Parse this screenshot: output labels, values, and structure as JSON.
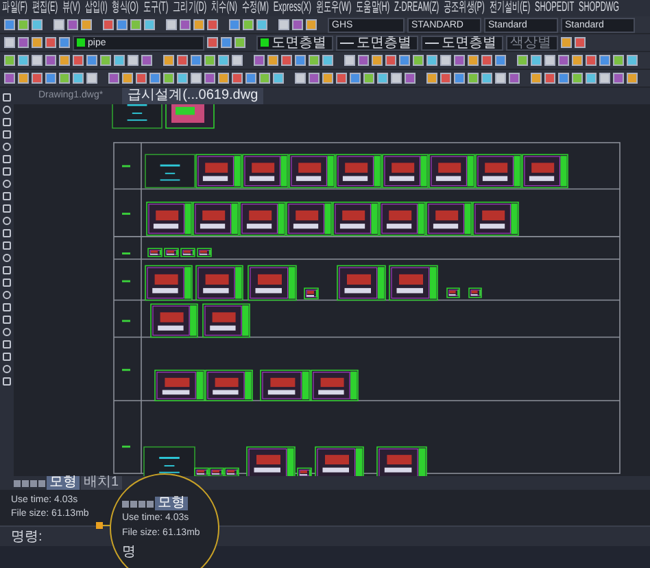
{
  "menu_bar": [
    "파일(F)",
    "편집(E)",
    "뷰(V)",
    "삽입(I)",
    "형식(O)",
    "도구(T)",
    "그리기(D)",
    "치수(N)",
    "수정(M)",
    "Express(X)",
    "윈도우(W)",
    "도움말(H)",
    "Z-DREAM(Z)",
    "공조위생(P)",
    "전기설비(E)",
    "SHOPEDIT",
    "SHOPDWG"
  ],
  "style_toolbar": {
    "dropdowns": [
      "GHS",
      "STANDARD",
      "Standard",
      "Standard"
    ]
  },
  "layer_toolbar": {
    "layer": "pipe",
    "color_mode": "도면층별",
    "linetype": "도면층별",
    "lineweight": "도면층별",
    "plot_style": "색상별"
  },
  "document_tabs": [
    {
      "label": "Drawing1.dwg*",
      "selected": false
    },
    {
      "label": "급시설계(...0619.dwg",
      "selected": true
    }
  ],
  "layout_tabs": [
    {
      "label": "모형",
      "selected": true
    },
    {
      "label": "배치1",
      "selected": false
    }
  ],
  "magnified_layout_tabs": [
    {
      "label": "모형",
      "selected": true
    }
  ],
  "command_history": [
    "Use time: 4.03s",
    "File size: 61.13mb"
  ],
  "magnified_history": [
    "Use time: 4.03s",
    "File size: 61.13mb"
  ],
  "command_prompt": "명령:",
  "magnified_prompt": "명"
}
